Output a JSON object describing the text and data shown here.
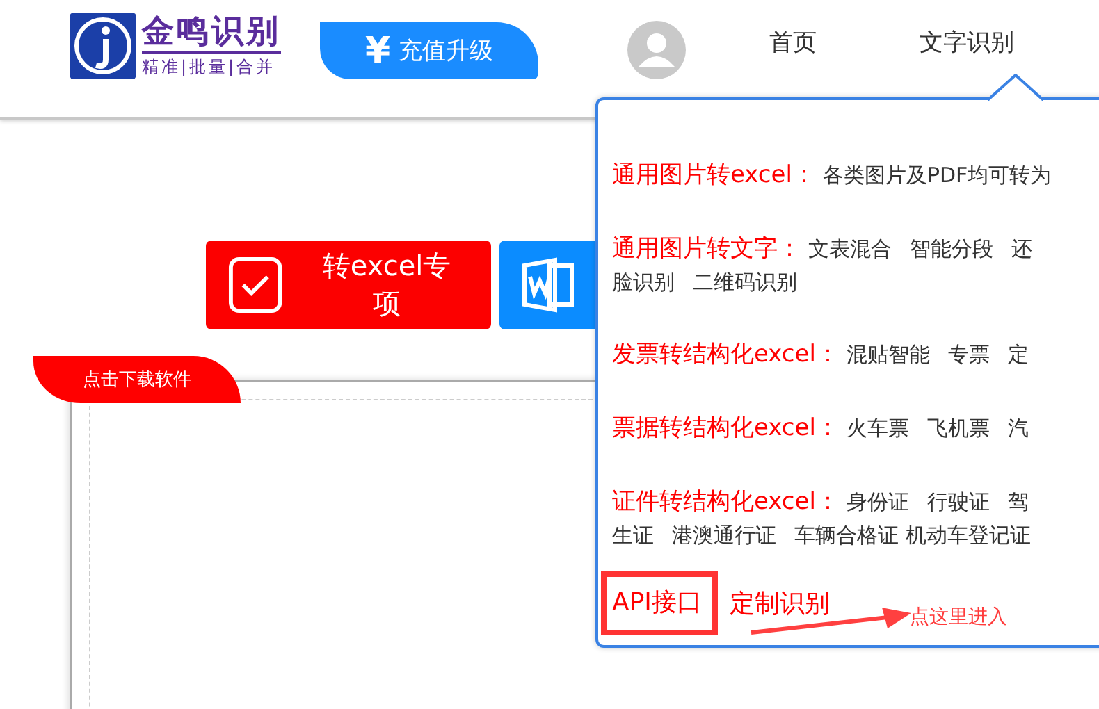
{
  "header": {
    "logo": {
      "name": "金鸣识别",
      "slogan": "精准|批量|合并"
    },
    "recharge": {
      "symbol": "¥",
      "label": "充值升级"
    },
    "nav": [
      "首页",
      "文字识别"
    ]
  },
  "main": {
    "buttons": [
      {
        "kind": "excel",
        "label": "转excel专项"
      },
      {
        "kind": "word"
      }
    ],
    "download_tab": "点击下载软件"
  },
  "dropdown": {
    "sections": [
      {
        "title": "通用图片转excel：",
        "items": [
          "各类图片及PDF均可转为"
        ]
      },
      {
        "title": "通用图片转文字：",
        "items": [
          "文表混合",
          "智能分段",
          "还"
        ],
        "more": [
          "脸识别",
          "二维码识别"
        ]
      },
      {
        "title": "发票转结构化excel：",
        "items": [
          "混贴智能",
          "专票",
          "定"
        ]
      },
      {
        "title": "票据转结构化excel：",
        "items": [
          "火车票",
          "飞机票",
          "汽"
        ]
      },
      {
        "title": "证件转结构化excel：",
        "items": [
          "身份证",
          "行驶证",
          "驾"
        ],
        "more": [
          "生证",
          "港澳通行证",
          "车辆合格证 机动车登记证"
        ]
      }
    ],
    "api": {
      "label": "API接口",
      "highlighted": true
    },
    "custom": "定制识别",
    "annotation": "点这里进入"
  }
}
